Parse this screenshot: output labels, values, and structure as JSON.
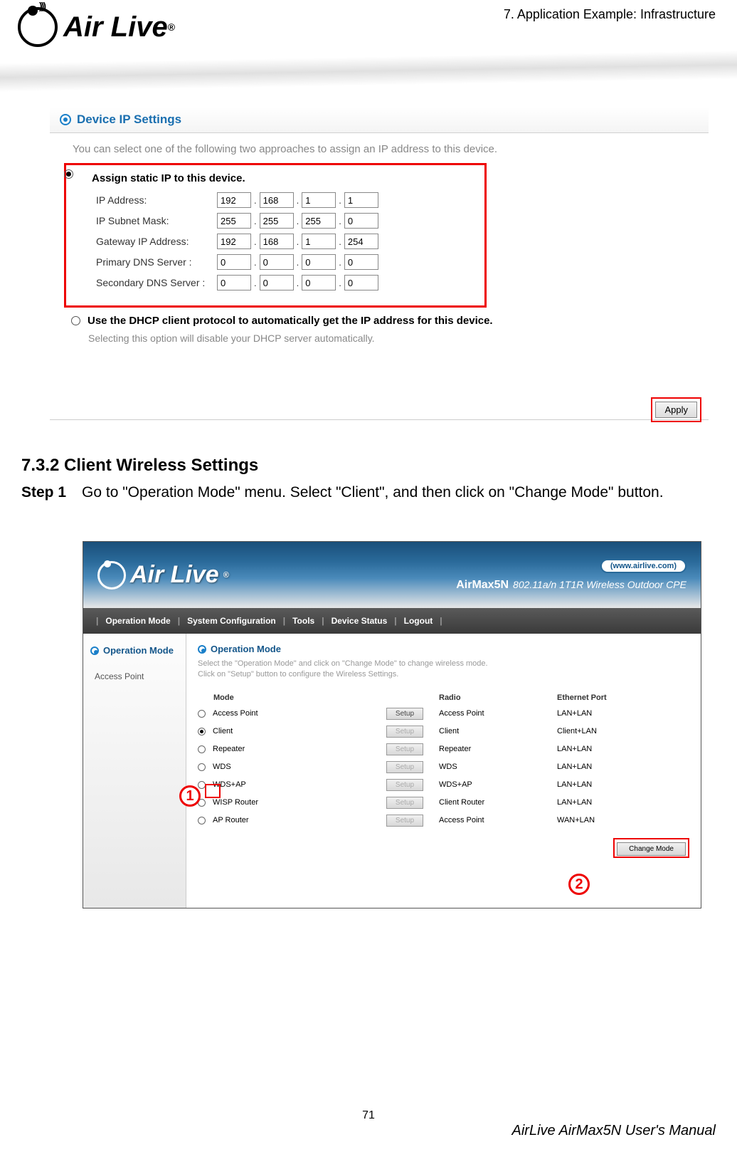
{
  "header": {
    "chapter": "7. Application Example: Infrastructure",
    "logo_text": "Air Live",
    "reg": "®"
  },
  "panel1": {
    "section_title": "Device IP Settings",
    "intro": "You can select one of the following two approaches to assign an IP address to this device.",
    "static_label": "Assign static IP to this device.",
    "rows": {
      "ip": {
        "label": "IP Address:",
        "a": "192",
        "b": "168",
        "c": "1",
        "d": "1"
      },
      "mask": {
        "label": "IP Subnet Mask:",
        "a": "255",
        "b": "255",
        "c": "255",
        "d": "0"
      },
      "gw": {
        "label": "Gateway IP Address:",
        "a": "192",
        "b": "168",
        "c": "1",
        "d": "254"
      },
      "pdns": {
        "label": "Primary DNS Server :",
        "a": "0",
        "b": "0",
        "c": "0",
        "d": "0"
      },
      "sdns": {
        "label": "Secondary DNS Server :",
        "a": "0",
        "b": "0",
        "c": "0",
        "d": "0"
      }
    },
    "dhcp_label": "Use the DHCP client protocol to automatically get the IP address for this device.",
    "dhcp_note": "Selecting this option will disable your DHCP server automatically.",
    "apply": "Apply"
  },
  "section": {
    "heading": "7.3.2 Client Wireless Settings",
    "step_label": "Step 1",
    "step_text": "Go to \"Operation Mode\" menu. Select \"Client\", and then click on \"Change Mode\" button."
  },
  "panel2": {
    "url": "(www.airlive.com)",
    "model": "AirMax5N",
    "model_desc": "802.11a/n 1T1R Wireless Outdoor CPE",
    "nav": [
      "Operation Mode",
      "System Configuration",
      "Tools",
      "Device Status",
      "Logout"
    ],
    "sidebar_head": "Operation Mode",
    "sidebar_item": "Access Point",
    "main_head": "Operation Mode",
    "desc1": "Select the \"Operation Mode\" and click on \"Change Mode\" to change wireless mode.",
    "desc2": "Click on \"Setup\" button to configure the Wireless Settings.",
    "cols": {
      "mode": "Mode",
      "radio": "Radio",
      "eth": "Ethernet Port"
    },
    "setup": "Setup",
    "rows": [
      {
        "name": "Access Point",
        "radio": "Access Point",
        "eth": "LAN+LAN",
        "checked": false,
        "enabled": true
      },
      {
        "name": "Client",
        "radio": "Client",
        "eth": "Client+LAN",
        "checked": true,
        "enabled": false
      },
      {
        "name": "Repeater",
        "radio": "Repeater",
        "eth": "LAN+LAN",
        "checked": false,
        "enabled": false
      },
      {
        "name": "WDS",
        "radio": "WDS",
        "eth": "LAN+LAN",
        "checked": false,
        "enabled": false
      },
      {
        "name": "WDS+AP",
        "radio": "WDS+AP",
        "eth": "LAN+LAN",
        "checked": false,
        "enabled": false
      },
      {
        "name": "WISP Router",
        "radio": "Client Router",
        "eth": "LAN+LAN",
        "checked": false,
        "enabled": false
      },
      {
        "name": "AP Router",
        "radio": "Access Point",
        "eth": "WAN+LAN",
        "checked": false,
        "enabled": false
      }
    ],
    "change_mode": "Change Mode",
    "callouts": {
      "c1": "1",
      "c2": "2"
    }
  },
  "footer": {
    "page": "71",
    "manual": "AirLive AirMax5N User's Manual"
  }
}
